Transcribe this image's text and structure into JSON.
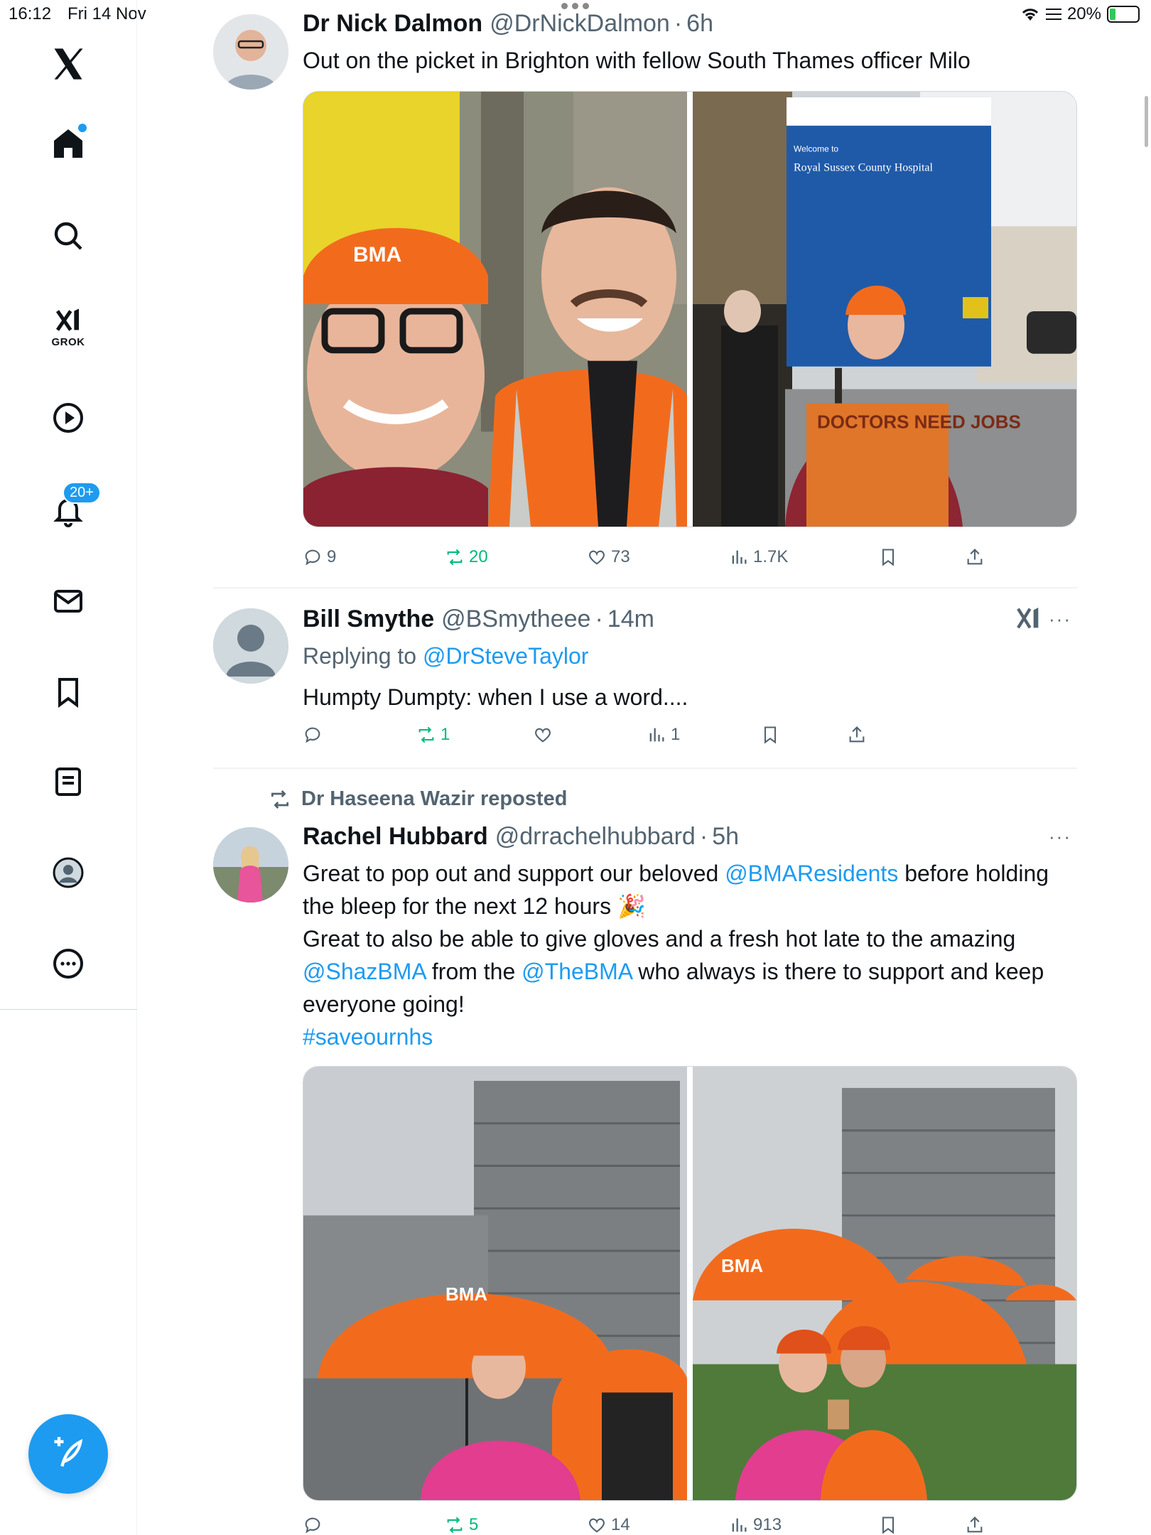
{
  "status_bar": {
    "time": "16:12",
    "date": "Fri 14 Nov",
    "battery": "20%",
    "battery_level": 0.2
  },
  "sidebar": {
    "grok_label": "GROK",
    "notification_count": "20+"
  },
  "posts": [
    {
      "name": "Dr Nick Dalmon",
      "handle": "@DrNickDalmon",
      "time": "6h",
      "text": "Out on the picket in Brighton with fellow South Thames officer Milo",
      "image_sign_welcome": "Welcome to",
      "image_sign_hospital": "Royal Sussex County Hospital",
      "image_placard": "DOCTORS NEED JOBS",
      "image_hat": "BMA",
      "actions": {
        "replies": "9",
        "reposts": "20",
        "likes": "73",
        "views": "1.7K"
      }
    },
    {
      "name": "Bill Smythe",
      "handle": "@BSmytheee",
      "time": "14m",
      "replying_prefix": "Replying to",
      "replying_handle": "@DrSteveTaylor",
      "text": "Humpty Dumpty: when I use a word....",
      "actions": {
        "replies": "",
        "reposts": "1",
        "likes": "",
        "views": "1"
      }
    },
    {
      "reposted_by": "Dr Haseena Wazir reposted",
      "name": "Rachel Hubbard",
      "handle": "@drrachelhubbard",
      "time": "5h",
      "text_1a": "Great to pop out and support our beloved ",
      "mention_1": "@BMAResidents",
      "text_1b": " before holding the bleep for the next 12 hours 🎉",
      "text_2": "Great to also be able to give gloves and a fresh hot late to the amazing ",
      "mention_2": "@ShazBMA",
      "text_3": " from the ",
      "mention_3": "@TheBMA",
      "text_4": " who always is there to support and keep everyone going!",
      "hashtag": "#saveournhs",
      "image_umbrella": "BMA",
      "actions": {
        "replies": "",
        "reposts": "5",
        "likes": "14",
        "views": "913"
      }
    }
  ],
  "colors": {
    "accent": "#1d9bf0",
    "repost_green": "#00ba7c",
    "muted": "#536471",
    "bma_orange": "#f26b1d"
  }
}
